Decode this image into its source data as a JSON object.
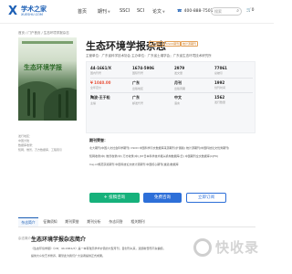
{
  "header": {
    "logo_mark": "X",
    "logo_text": "学术之家",
    "logo_sub": "XUESHU.COM",
    "nav": [
      {
        "label": "首页",
        "has_caret": false
      },
      {
        "label": "期刊",
        "has_caret": true
      },
      {
        "label": "SSCI",
        "has_caret": false
      },
      {
        "label": "SCI",
        "has_caret": false
      },
      {
        "label": "论文",
        "has_caret": true
      }
    ],
    "phone_icon": "phone-icon",
    "phone": "400-888-7501",
    "search_placeholder": "搜索",
    "search_icon": "search-icon",
    "cart_icon": "cart-icon",
    "cart_label": "0"
  },
  "breadcrumb": "首页 / 门户首页 / 生态环境学报杂志",
  "cover": {
    "title": "生态环境学报"
  },
  "journal": {
    "title": "生态环境学报杂志",
    "tags": [
      "北大期刊",
      "CSCD期刊",
      "统计源期刊"
    ],
    "subinfo": "主管单位：广东省科学技术协会  主办单位：广东省土壤学会；广东省生态环境技术研究所"
  },
  "info": [
    {
      "value": "44-1661/X",
      "key": "国内刊号"
    },
    {
      "value": "1674-5906",
      "key": "国际刊号"
    },
    {
      "value": "2979",
      "key": "发文量"
    },
    {
      "value": "77061",
      "key": "总被引"
    },
    {
      "value": "¥ 1040.00",
      "key": "全年定价",
      "red": true
    },
    {
      "value": "广东",
      "key": "出版地区"
    },
    {
      "value": "月刊",
      "key": "出版周期"
    },
    {
      "value": "1992",
      "key": "创刊时间"
    },
    {
      "value": "陶波-王于松",
      "key": "主编"
    },
    {
      "value": "广东",
      "key": "邮发代号"
    },
    {
      "value": "中文",
      "key": "语言"
    },
    {
      "value": "1562",
      "key": "发行数量"
    }
  ],
  "side_small": [
    "发行地区：",
    "中国大陆",
    "数据库收录：",
    "知网，维普，万方数据库，工程索引"
  ],
  "awards": {
    "heading": "期刊荣誉：",
    "lines": [
      "北大期刊(中国人文社会科学期刊)  CSCD 中国科学引文数据库来源期刊(扩展版)  统计源期刊(中国科技论文优秀期刊)",
      "知网收录(中)  维普收录(中)  万方收录(中)  JST日本科学技术振兴机构数据库(日)  中国期刊全文数据库(CJFD)",
      "Caj-cd规范获奖期刊  中国科技论文统计源期刊  中国核心期刊(遴选)数据库"
    ]
  },
  "buttons": {
    "primary": "✈ 投稿咨询",
    "secondary": "免费咨询",
    "outline": "立即订阅"
  },
  "tabs": [
    "杂志简介",
    "征稿须知",
    "期刊荣誉",
    "期刊分析",
    "杂志问答",
    "相关期刊"
  ],
  "active_tab": 0,
  "intro": {
    "label": "杂志简介",
    "title": "生态环境学报杂志简介",
    "paragraphs": [
      "《生态环境学报》（CN：44-1661/X）是一本有较高学术价值的大型月刊，自创刊以来，选题新奇而不失偏颇，",
      "提供大众化艺术修养，期望此为我们广大读者提供正式成果。"
    ]
  },
  "watermark": "快收录"
}
